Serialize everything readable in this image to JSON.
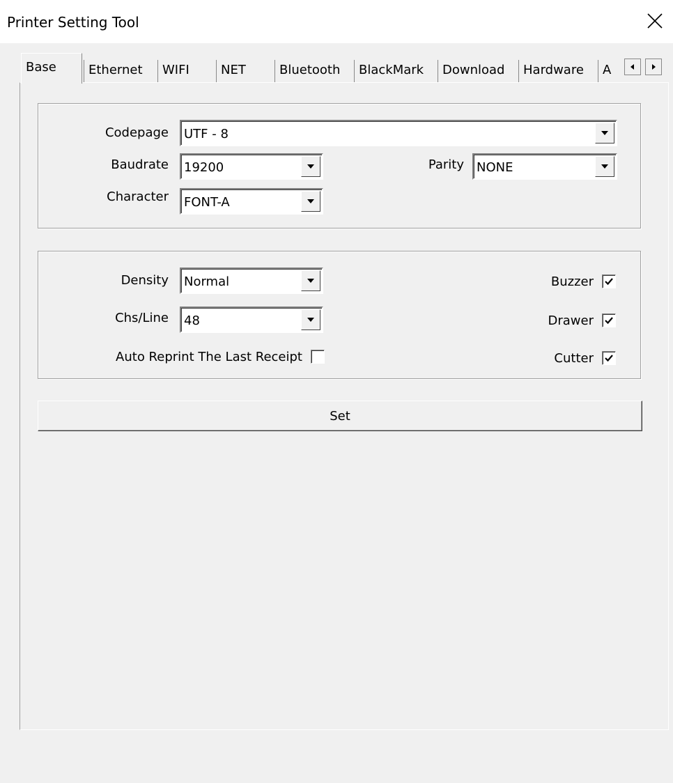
{
  "window": {
    "title": "Printer Setting Tool"
  },
  "tabs": [
    {
      "label": "Base",
      "active": true
    },
    {
      "label": "Ethernet"
    },
    {
      "label": "WIFI"
    },
    {
      "label": "NET"
    },
    {
      "label": "Bluetooth"
    },
    {
      "label": "BlackMark"
    },
    {
      "label": "Download"
    },
    {
      "label": "Hardware"
    },
    {
      "label": "A"
    }
  ],
  "group1": {
    "codepage": {
      "label": "Codepage",
      "value": "UTF - 8"
    },
    "baudrate": {
      "label": "Baudrate",
      "value": "19200"
    },
    "parity": {
      "label": "Parity",
      "value": "NONE"
    },
    "character": {
      "label": "Character",
      "value": "FONT-A"
    }
  },
  "group2": {
    "density": {
      "label": "Density",
      "value": "Normal"
    },
    "chs_line": {
      "label": "Chs/Line",
      "value": "48"
    },
    "auto_reprint": {
      "label": "Auto Reprint The Last Receipt",
      "checked": false
    },
    "buzzer": {
      "label": "Buzzer",
      "checked": true
    },
    "drawer": {
      "label": "Drawer",
      "checked": true
    },
    "cutter": {
      "label": "Cutter",
      "checked": true
    }
  },
  "actions": {
    "set_label": "Set"
  },
  "icons": {
    "close": "close-icon",
    "scroll_left": "arrow-left-icon",
    "scroll_right": "arrow-right-icon",
    "dropdown": "chevron-down-icon",
    "check": "checkmark-icon"
  }
}
